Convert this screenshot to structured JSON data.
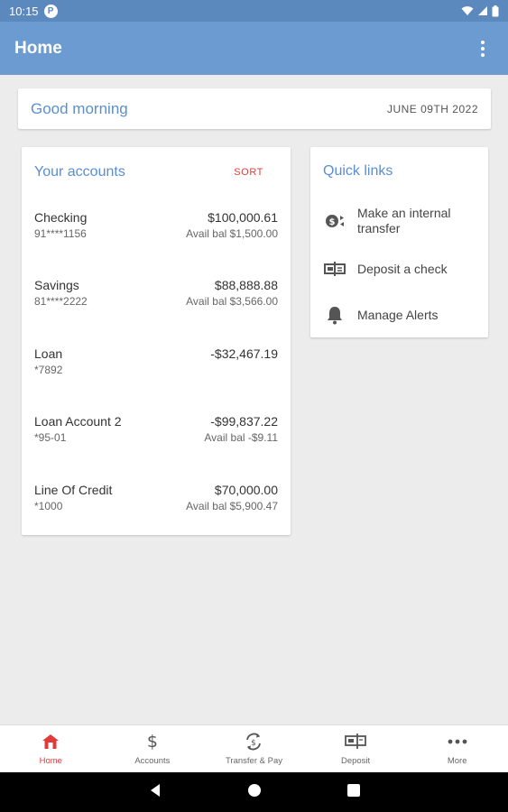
{
  "status": {
    "time": "10:15",
    "notif_badge": "P"
  },
  "app_bar": {
    "title": "Home"
  },
  "greeting": {
    "text": "Good morning",
    "date": "JUNE 09TH 2022"
  },
  "accounts": {
    "title": "Your accounts",
    "sort_label": "SORT",
    "rows": [
      {
        "name": "Checking",
        "number": "91****1156",
        "amount": "$100,000.61",
        "avail": "Avail bal $1,500.00"
      },
      {
        "name": "Savings",
        "number": "81****2222",
        "amount": "$88,888.88",
        "avail": "Avail bal $3,566.00"
      },
      {
        "name": "Loan",
        "number": "*7892",
        "amount": "-$32,467.19",
        "avail": ""
      },
      {
        "name": "Loan Account 2",
        "number": "*95-01",
        "amount": "-$99,837.22",
        "avail": "Avail bal -$9.11"
      },
      {
        "name": "Line Of Credit",
        "number": "*1000",
        "amount": "$70,000.00",
        "avail": "Avail bal $5,900.47"
      }
    ]
  },
  "quick_links": {
    "title": "Quick links",
    "items": [
      {
        "label": "Make an internal transfer",
        "icon": "transfer-icon"
      },
      {
        "label": "Deposit a check",
        "icon": "check-icon"
      },
      {
        "label": "Manage Alerts",
        "icon": "bell-icon"
      }
    ]
  },
  "bottom_nav": {
    "items": [
      {
        "label": "Home",
        "icon": "home-icon",
        "active": true
      },
      {
        "label": "Accounts",
        "icon": "dollar-icon",
        "active": false
      },
      {
        "label": "Transfer & Pay",
        "icon": "transfer-pay-icon",
        "active": false
      },
      {
        "label": "Deposit",
        "icon": "deposit-icon",
        "active": false
      },
      {
        "label": "More",
        "icon": "more-icon",
        "active": false
      }
    ]
  },
  "colors": {
    "app_bar": "#6b9bd1",
    "status_bar": "#5b89bd",
    "accent_blue": "#5b8fd0",
    "accent_red": "#e03a3a"
  }
}
